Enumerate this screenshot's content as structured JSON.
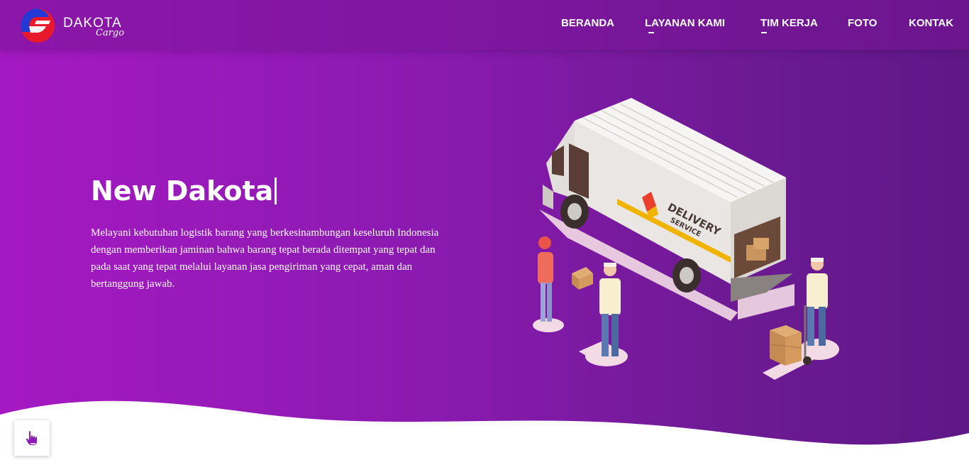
{
  "brand": {
    "name": "DAKOTA",
    "sub": "Cargo",
    "logo_icon": "dakota-logo-icon"
  },
  "nav": {
    "items": [
      {
        "label": "BERANDA",
        "active": false
      },
      {
        "label": "LAYANAN KAMI",
        "active": true
      },
      {
        "label": "TIM KERJA",
        "active": true
      },
      {
        "label": "FOTO",
        "active": false
      },
      {
        "label": "KONTAK",
        "active": false
      }
    ]
  },
  "hero": {
    "title": "New Dakota",
    "description": "Melayani kebutuhan logistik barang yang berkesinambungan keseluruh Indonesia dengan memberikan jaminan bahwa barang tepat berada ditempat yang tepat dan pada saat yang tepat melalui layanan jasa pengiriman yang cepat, aman dan bertanggung jawab.",
    "illustration_icon": "delivery-truck-illustration",
    "truck_label_1": "DELIVERY",
    "truck_label_2": "SERVICE"
  },
  "scroll_button": {
    "icon": "pointer-hand-icon"
  },
  "colors": {
    "gradient_start": "#a519c2",
    "gradient_end": "#5f1887",
    "logo_blue": "#2438d6",
    "logo_red": "#e8192c",
    "button_icon": "#8e1ab8"
  }
}
